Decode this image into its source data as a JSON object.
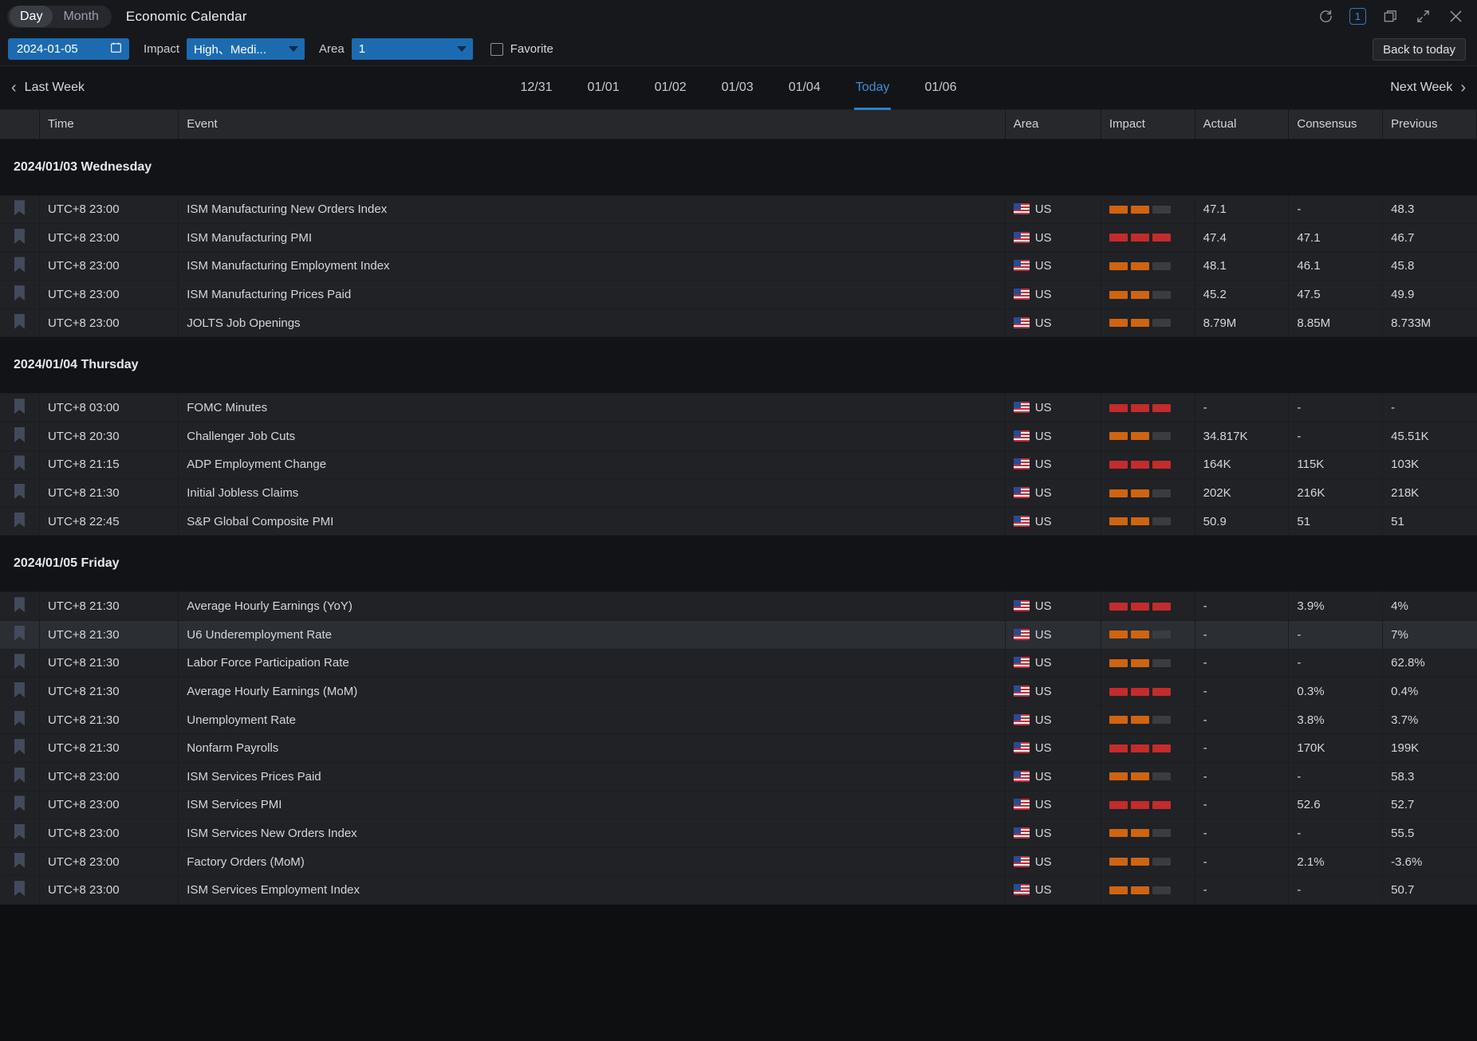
{
  "titlebar": {
    "view_day": "Day",
    "view_month": "Month",
    "title": "Economic Calendar",
    "icons": {
      "refresh": "refresh-icon",
      "count_badge": "1",
      "window": "restore-window-icon",
      "expand": "expand-icon",
      "close": "close-icon"
    }
  },
  "filterbar": {
    "date_value": "2024-01-05",
    "calendar_icon": "calendar-icon",
    "impact_label": "Impact",
    "impact_value": "High、Medi...",
    "area_label": "Area",
    "area_value": "1",
    "favorite_label": "Favorite",
    "favorite_checked": false,
    "back_to_today": "Back to today"
  },
  "weeknav": {
    "last_week": "Last Week",
    "next_week": "Next Week",
    "days": [
      {
        "label": "12/31",
        "active": false
      },
      {
        "label": "01/01",
        "active": false
      },
      {
        "label": "01/02",
        "active": false
      },
      {
        "label": "01/03",
        "active": false
      },
      {
        "label": "01/04",
        "active": false
      },
      {
        "label": "Today",
        "active": true
      },
      {
        "label": "01/06",
        "active": false
      }
    ]
  },
  "table": {
    "headers": {
      "flag": "",
      "time": "Time",
      "event": "Event",
      "area": "Area",
      "impact": "Impact",
      "actual": "Actual",
      "consensus": "Consensus",
      "previous": "Previous"
    },
    "groups": [
      {
        "title": "2024/01/03 Wednesday",
        "rows": [
          {
            "bookmark": "bookmark-icon",
            "time": "UTC+8 23:00",
            "event": "ISM Manufacturing New Orders Index",
            "area": "US",
            "flag": "us-flag-icon",
            "impact": "medium",
            "actual": "47.1",
            "consensus": "-",
            "previous": "48.3",
            "hover": false
          },
          {
            "bookmark": "bookmark-icon",
            "time": "UTC+8 23:00",
            "event": "ISM Manufacturing PMI",
            "area": "US",
            "flag": "us-flag-icon",
            "impact": "high",
            "actual": "47.4",
            "consensus": "47.1",
            "previous": "46.7",
            "hover": false
          },
          {
            "bookmark": "bookmark-icon",
            "time": "UTC+8 23:00",
            "event": "ISM Manufacturing Employment Index",
            "area": "US",
            "flag": "us-flag-icon",
            "impact": "medium",
            "actual": "48.1",
            "consensus": "46.1",
            "previous": "45.8",
            "hover": false
          },
          {
            "bookmark": "bookmark-icon",
            "time": "UTC+8 23:00",
            "event": "ISM Manufacturing Prices Paid",
            "area": "US",
            "flag": "us-flag-icon",
            "impact": "medium",
            "actual": "45.2",
            "consensus": "47.5",
            "previous": "49.9",
            "hover": false
          },
          {
            "bookmark": "bookmark-icon",
            "time": "UTC+8 23:00",
            "event": "JOLTS Job Openings",
            "area": "US",
            "flag": "us-flag-icon",
            "impact": "medium",
            "actual": "8.79M",
            "consensus": "8.85M",
            "previous": "8.733M",
            "hover": false
          }
        ]
      },
      {
        "title": "2024/01/04 Thursday",
        "rows": [
          {
            "bookmark": "bookmark-icon",
            "time": "UTC+8 03:00",
            "event": "FOMC Minutes",
            "area": "US",
            "flag": "us-flag-icon",
            "impact": "high",
            "actual": "-",
            "consensus": "-",
            "previous": "-",
            "hover": false
          },
          {
            "bookmark": "bookmark-icon",
            "time": "UTC+8 20:30",
            "event": "Challenger Job Cuts",
            "area": "US",
            "flag": "us-flag-icon",
            "impact": "medium",
            "actual": "34.817K",
            "consensus": "-",
            "previous": "45.51K",
            "hover": false
          },
          {
            "bookmark": "bookmark-icon",
            "time": "UTC+8 21:15",
            "event": "ADP Employment Change",
            "area": "US",
            "flag": "us-flag-icon",
            "impact": "high",
            "actual": "164K",
            "consensus": "115K",
            "previous": "103K",
            "hover": false
          },
          {
            "bookmark": "bookmark-icon",
            "time": "UTC+8 21:30",
            "event": "Initial Jobless Claims",
            "area": "US",
            "flag": "us-flag-icon",
            "impact": "medium",
            "actual": "202K",
            "consensus": "216K",
            "previous": "218K",
            "hover": false
          },
          {
            "bookmark": "bookmark-icon",
            "time": "UTC+8 22:45",
            "event": "S&P Global Composite PMI",
            "area": "US",
            "flag": "us-flag-icon",
            "impact": "medium",
            "actual": "50.9",
            "consensus": "51",
            "previous": "51",
            "hover": false
          }
        ]
      },
      {
        "title": "2024/01/05 Friday",
        "rows": [
          {
            "bookmark": "bookmark-icon",
            "time": "UTC+8 21:30",
            "event": "Average Hourly Earnings (YoY)",
            "area": "US",
            "flag": "us-flag-icon",
            "impact": "high",
            "actual": "-",
            "consensus": "3.9%",
            "previous": "4%",
            "hover": false
          },
          {
            "bookmark": "bookmark-icon",
            "time": "UTC+8 21:30",
            "event": "U6 Underemployment Rate",
            "area": "US",
            "flag": "us-flag-icon",
            "impact": "medium",
            "actual": "-",
            "consensus": "-",
            "previous": "7%",
            "hover": true
          },
          {
            "bookmark": "bookmark-icon",
            "time": "UTC+8 21:30",
            "event": "Labor Force Participation Rate",
            "area": "US",
            "flag": "us-flag-icon",
            "impact": "medium",
            "actual": "-",
            "consensus": "-",
            "previous": "62.8%",
            "hover": false
          },
          {
            "bookmark": "bookmark-icon",
            "time": "UTC+8 21:30",
            "event": "Average Hourly Earnings (MoM)",
            "area": "US",
            "flag": "us-flag-icon",
            "impact": "high",
            "actual": "-",
            "consensus": "0.3%",
            "previous": "0.4%",
            "hover": false
          },
          {
            "bookmark": "bookmark-icon",
            "time": "UTC+8 21:30",
            "event": "Unemployment Rate",
            "area": "US",
            "flag": "us-flag-icon",
            "impact": "medium",
            "actual": "-",
            "consensus": "3.8%",
            "previous": "3.7%",
            "hover": false
          },
          {
            "bookmark": "bookmark-icon",
            "time": "UTC+8 21:30",
            "event": "Nonfarm Payrolls",
            "area": "US",
            "flag": "us-flag-icon",
            "impact": "high",
            "actual": "-",
            "consensus": "170K",
            "previous": "199K",
            "hover": false
          },
          {
            "bookmark": "bookmark-icon",
            "time": "UTC+8 23:00",
            "event": "ISM Services Prices Paid",
            "area": "US",
            "flag": "us-flag-icon",
            "impact": "medium",
            "actual": "-",
            "consensus": "-",
            "previous": "58.3",
            "hover": false
          },
          {
            "bookmark": "bookmark-icon",
            "time": "UTC+8 23:00",
            "event": "ISM Services PMI",
            "area": "US",
            "flag": "us-flag-icon",
            "impact": "high",
            "actual": "-",
            "consensus": "52.6",
            "previous": "52.7",
            "hover": false
          },
          {
            "bookmark": "bookmark-icon",
            "time": "UTC+8 23:00",
            "event": "ISM Services New Orders Index",
            "area": "US",
            "flag": "us-flag-icon",
            "impact": "medium",
            "actual": "-",
            "consensus": "-",
            "previous": "55.5",
            "hover": false
          },
          {
            "bookmark": "bookmark-icon",
            "time": "UTC+8 23:00",
            "event": "Factory Orders (MoM)",
            "area": "US",
            "flag": "us-flag-icon",
            "impact": "medium",
            "actual": "-",
            "consensus": "2.1%",
            "previous": "-3.6%",
            "hover": false
          },
          {
            "bookmark": "bookmark-icon",
            "time": "UTC+8 23:00",
            "event": "ISM Services Employment Index",
            "area": "US",
            "flag": "us-flag-icon",
            "impact": "medium",
            "actual": "-",
            "consensus": "-",
            "previous": "50.7",
            "hover": false
          }
        ]
      }
    ]
  },
  "colors": {
    "accent": "#2f7fc4",
    "impact_high": "#c42b2b",
    "impact_medium": "#cf6411",
    "impact_empty": "#3a3c40"
  }
}
